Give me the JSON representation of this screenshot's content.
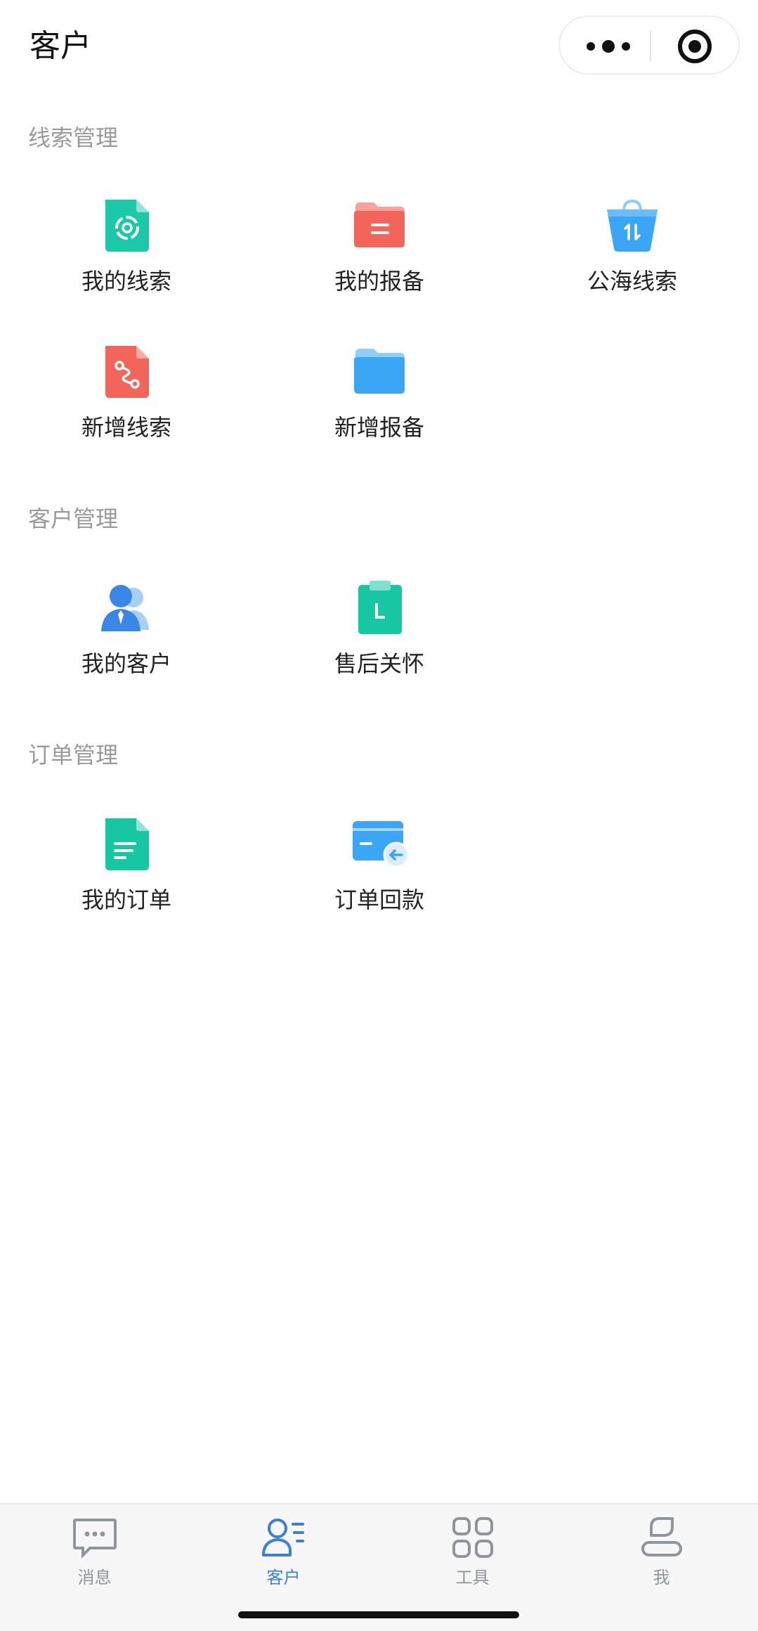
{
  "header": {
    "title": "客户",
    "more_icon": "more-dots-icon",
    "close_icon": "target-icon"
  },
  "sections": [
    {
      "title": "线索管理",
      "items": [
        {
          "label": "我的线索",
          "icon": "target-doc-icon",
          "color": "#1bc9a8"
        },
        {
          "label": "我的报备",
          "icon": "red-folder-icon",
          "color": "#f3645a"
        },
        {
          "label": "公海线索",
          "icon": "shopping-bag-icon",
          "color": "#3aa6f5"
        },
        {
          "label": "新增线索",
          "icon": "route-doc-icon",
          "color": "#f3645a"
        },
        {
          "label": "新增报备",
          "icon": "blue-folder-icon",
          "color": "#3aa6f5"
        }
      ]
    },
    {
      "title": "客户管理",
      "items": [
        {
          "label": "我的客户",
          "icon": "customers-icon",
          "color": "#3a86e6"
        },
        {
          "label": "售后关怀",
          "icon": "clipboard-icon",
          "color": "#17c6a3"
        }
      ]
    },
    {
      "title": "订单管理",
      "items": [
        {
          "label": "我的订单",
          "icon": "order-doc-icon",
          "color": "#17c6a3"
        },
        {
          "label": "订单回款",
          "icon": "payment-card-icon",
          "color": "#3aa6f5"
        }
      ]
    }
  ],
  "tabbar": {
    "tabs": [
      {
        "label": "消息",
        "icon": "chat-bubble-icon",
        "active": false
      },
      {
        "label": "客户",
        "icon": "customer-list-icon",
        "active": true
      },
      {
        "label": "工具",
        "icon": "grid-icon",
        "active": false
      },
      {
        "label": "我",
        "icon": "person-icon",
        "active": false
      }
    ],
    "active_color": "#3b7fd6",
    "inactive_color": "#8e959c"
  }
}
